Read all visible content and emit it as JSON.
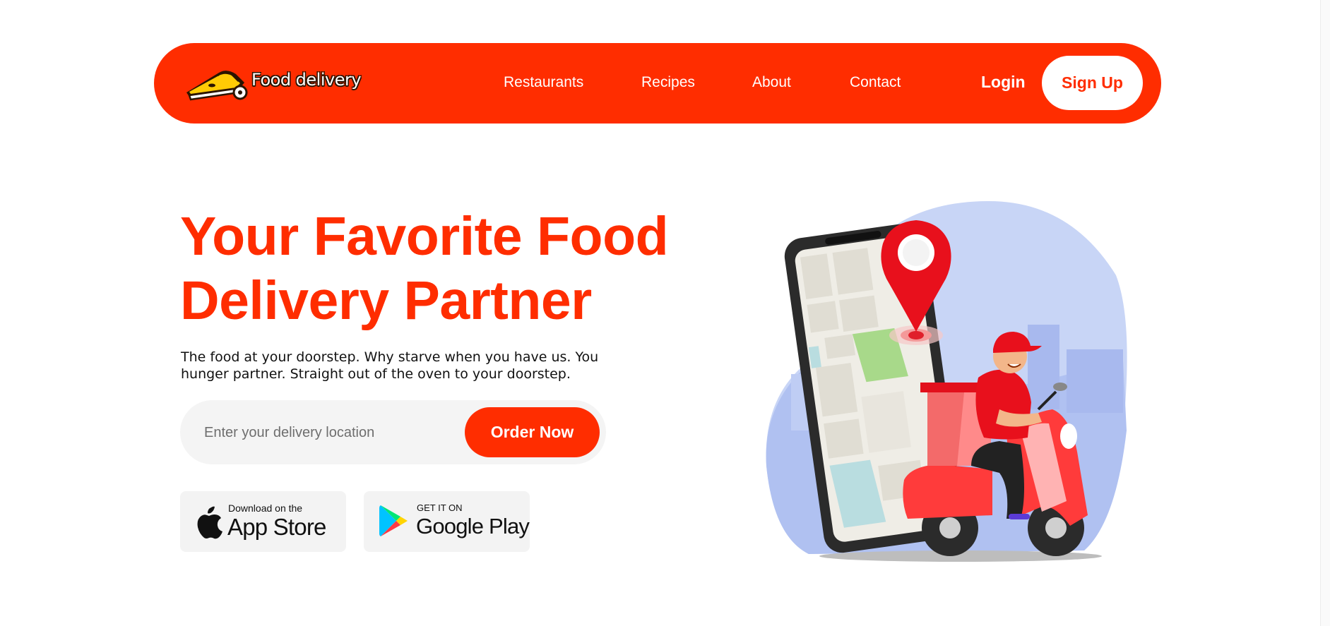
{
  "brand": {
    "name": "Food delivery",
    "accent_color": "#ff2d00"
  },
  "nav": {
    "links": [
      "Restaurants",
      "Recipes",
      "About",
      "Contact"
    ],
    "login_label": "Login",
    "signup_label": "Sign Up"
  },
  "hero": {
    "title_line1": "Your Favorite Food",
    "title_line2": "Delivery Partner",
    "description_line1": "The food at your doorstep. Why starve when you have us. You",
    "description_line2": "hunger partner. Straight out of the oven to your doorstep."
  },
  "search": {
    "placeholder": "Enter your delivery location",
    "button_label": "Order Now"
  },
  "app_badges": {
    "app_store": {
      "small_text": "Download on the",
      "big_text": "App Store",
      "icon": "apple-icon"
    },
    "google_play": {
      "small_text": "GET IT ON",
      "big_text": "Google Play",
      "icon": "google-play-icon"
    }
  },
  "illustration": {
    "icon": "delivery-scooter-phone-map-illustration"
  }
}
